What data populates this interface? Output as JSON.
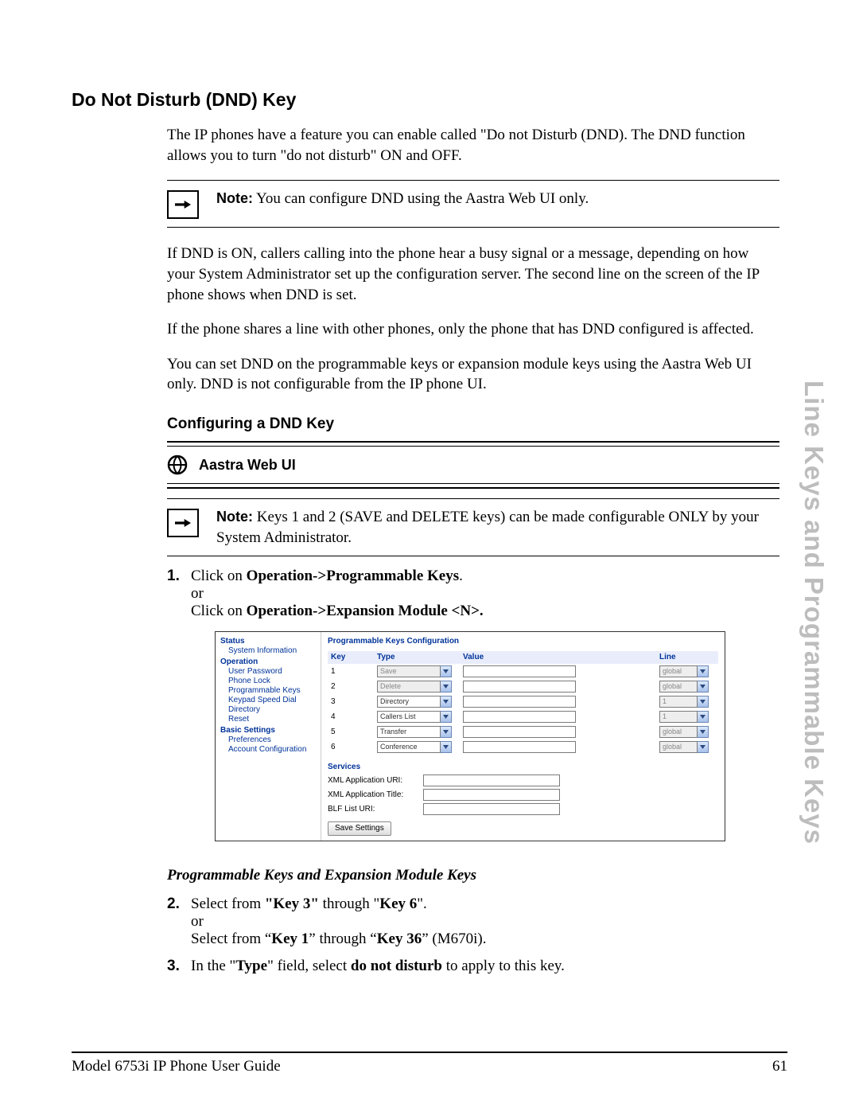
{
  "heading": "Do Not Disturb (DND) Key",
  "intro": "The IP phones have a feature you can enable called \"Do not Disturb (DND). The DND function allows you to turn \"do not disturb\" ON and OFF.",
  "note1_label": "Note:",
  "note1": " You can configure DND using the Aastra Web UI only.",
  "para2": "If DND is ON, callers calling into the phone hear a busy signal or a message, depending on how your System Administrator set up the configuration server. The second line on the screen of the IP phone shows when DND is set.",
  "para3": "If the phone shares a line with other phones, only the phone that has DND configured is affected.",
  "para4": "You can set DND on the programmable keys or expansion module keys using the Aastra Web UI only. DND is not configurable from the IP phone UI.",
  "subheading": "Configuring a DND Key",
  "webui_label": "Aastra Web UI",
  "note2_label": "Note:",
  "note2": " Keys 1 and 2 (SAVE and DELETE keys) can be made configurable ONLY by your System Administrator.",
  "step1_a": "Click on ",
  "step1_b": "Operation->Programmable Keys",
  "step1_c": ".",
  "step1_or": "or",
  "step1_d": "Click on ",
  "step1_e": "Operation->Expansion Module <N>.",
  "screenshot": {
    "side": {
      "groups": [
        {
          "head": "Status",
          "items": [
            "System Information"
          ]
        },
        {
          "head": "Operation",
          "items": [
            "User Password",
            "Phone Lock",
            "Programmable Keys",
            "Keypad Speed Dial",
            "Directory",
            "Reset"
          ]
        },
        {
          "head": "Basic Settings",
          "items": [
            "Preferences",
            "Account Configuration"
          ]
        }
      ]
    },
    "title": "Programmable Keys Configuration",
    "cols": [
      "Key",
      "Type",
      "Value",
      "Line"
    ],
    "rows": [
      {
        "key": "1",
        "type": "Save",
        "type_dis": true,
        "line": "global",
        "line_dis": true
      },
      {
        "key": "2",
        "type": "Delete",
        "type_dis": true,
        "line": "global",
        "line_dis": true
      },
      {
        "key": "3",
        "type": "Directory",
        "type_dis": false,
        "line": "1",
        "line_dis": true
      },
      {
        "key": "4",
        "type": "Callers List",
        "type_dis": false,
        "line": "1",
        "line_dis": true
      },
      {
        "key": "5",
        "type": "Transfer",
        "type_dis": false,
        "line": "global",
        "line_dis": true
      },
      {
        "key": "6",
        "type": "Conference",
        "type_dis": false,
        "line": "global",
        "line_dis": true
      }
    ],
    "services_head": "Services",
    "services": [
      "XML Application URI:",
      "XML Application Title:",
      "BLF List URI:"
    ],
    "save": "Save Settings"
  },
  "italic_head": "Programmable Keys and Expansion Module Keys",
  "step2_a": "Select from ",
  "step2_b": "\"Key 3\"",
  "step2_c": " through \"",
  "step2_d": "Key 6",
  "step2_e": "\".",
  "step2_or": "or",
  "step2_f": "Select from “",
  "step2_g": "Key 1",
  "step2_h": "” through “",
  "step2_i": "Key 36",
  "step2_j": "” (M670i).",
  "step3_a": "In the \"",
  "step3_b": "Type",
  "step3_c": "\" field, select ",
  "step3_d": "do not disturb",
  "step3_e": " to apply to this key.",
  "footer_left": "Model 6753i IP Phone User Guide",
  "footer_right": "61",
  "side_tab": "Line Keys and Programmable Keys"
}
